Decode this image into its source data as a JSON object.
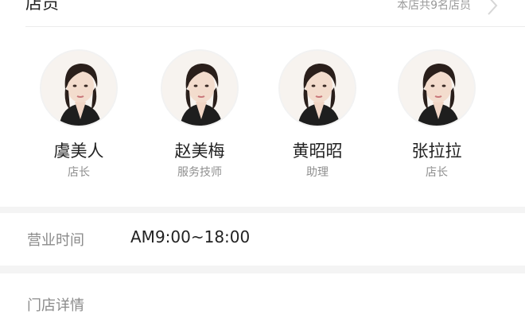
{
  "staff": {
    "title": "店员",
    "count_text": "本店共9名店员",
    "members": [
      {
        "name": "虞美人",
        "role": "店长"
      },
      {
        "name": "赵美梅",
        "role": "服务技师"
      },
      {
        "name": "黄昭昭",
        "role": "助理"
      },
      {
        "name": "张拉拉",
        "role": "店长"
      }
    ]
  },
  "hours": {
    "label": "营业时间",
    "value": "AM9:00~18:00"
  },
  "detail": {
    "label": "门店详情"
  },
  "colors": {
    "background": "#f4f4f4",
    "card": "#ffffff",
    "primary_text": "#222222",
    "secondary_text": "#8f8f8f",
    "divider": "#ececec"
  },
  "icons": {
    "more": "chevron-right-icon",
    "avatar": "avatar-portrait"
  }
}
